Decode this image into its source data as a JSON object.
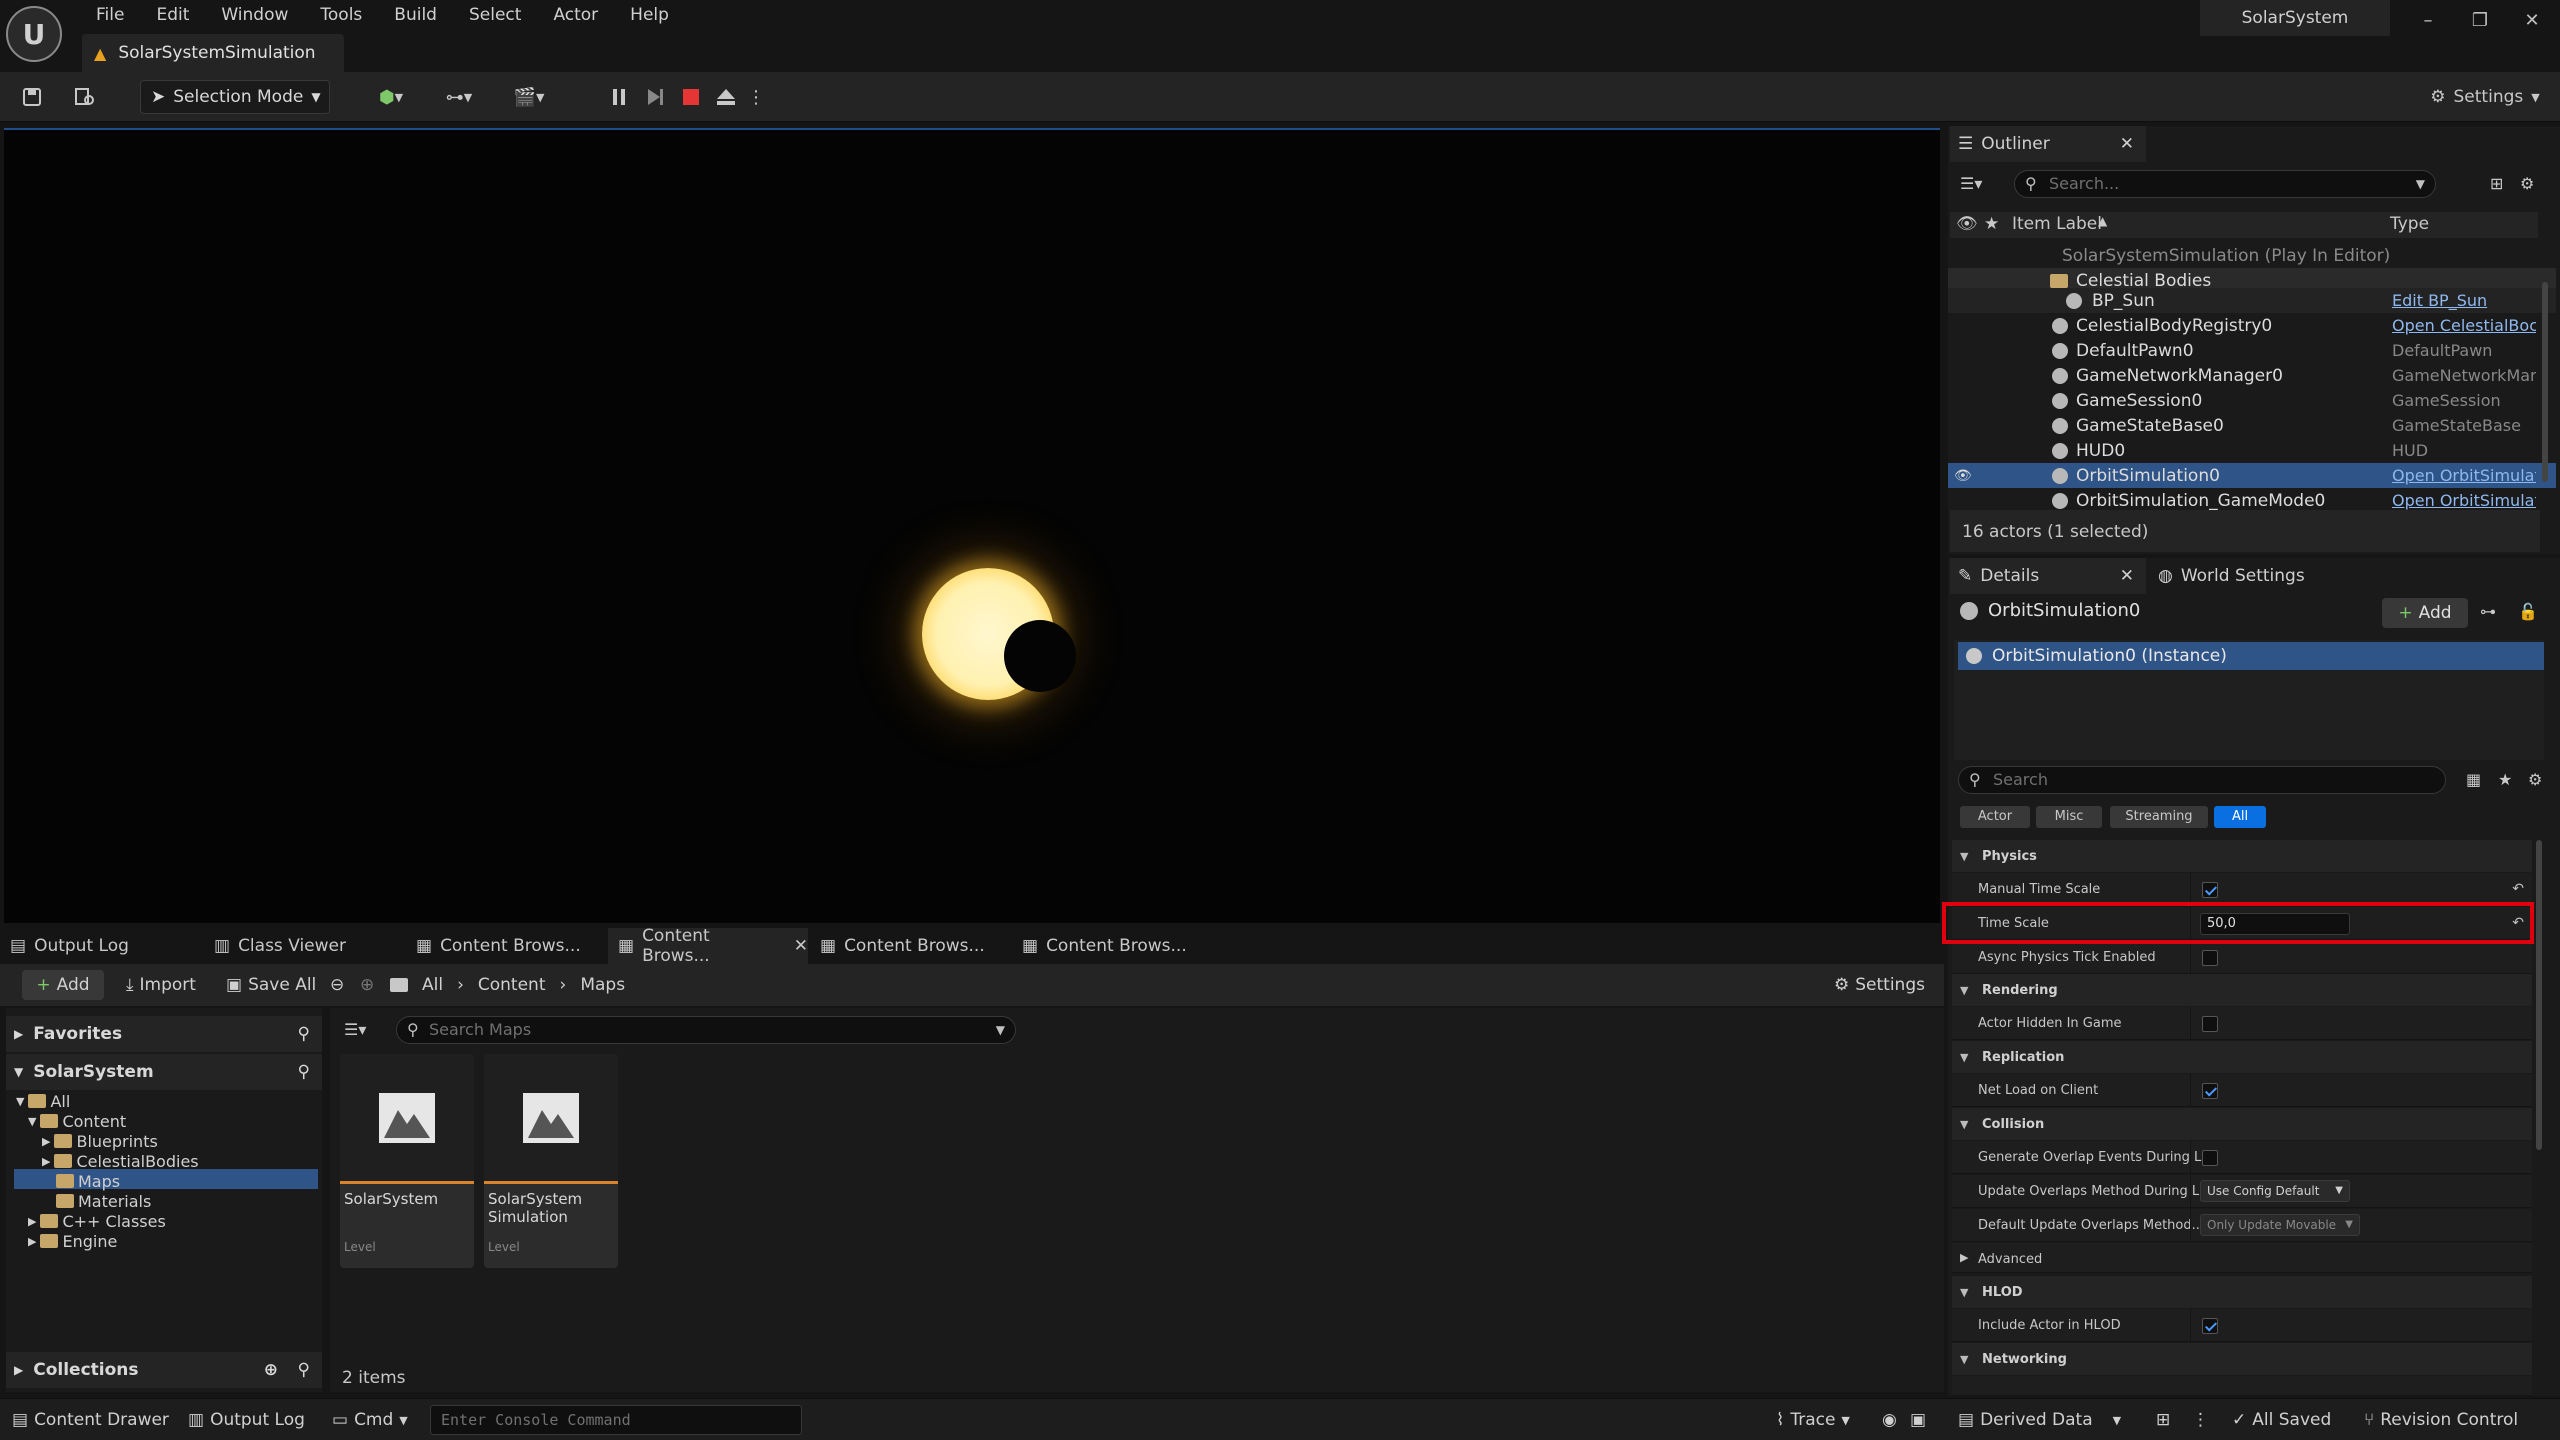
{
  "menu": [
    "File",
    "Edit",
    "Window",
    "Tools",
    "Build",
    "Select",
    "Actor",
    "Help"
  ],
  "doc_tab": "SolarSystemSimulation",
  "project_name": "SolarSystem",
  "toolbar": {
    "selection_mode": "Selection Mode",
    "settings": "Settings"
  },
  "bottom_tabs": [
    "Output Log",
    "Class Viewer",
    "Content Brows...",
    "Content Brows...",
    "Content Brows...",
    "Content Brows..."
  ],
  "content_browser": {
    "add": "Add",
    "import": "Import",
    "save_all": "Save All",
    "path": [
      "All",
      "Content",
      "Maps"
    ],
    "settings": "Settings",
    "favorites": "Favorites",
    "root": "SolarSystem",
    "tree": {
      "all": "All",
      "content": "Content",
      "blueprints": "Blueprints",
      "celestial": "CelestialBodies",
      "maps": "Maps",
      "materials": "Materials",
      "cpp": "C++ Classes",
      "engine": "Engine"
    },
    "search_placeholder": "Search Maps",
    "collections": "Collections",
    "assets": [
      {
        "name": "SolarSystem",
        "kind": "Level"
      },
      {
        "name": "SolarSystem Simulation",
        "kind": "Level"
      }
    ],
    "item_count": "2 items"
  },
  "status": {
    "content_drawer": "Content Drawer",
    "output_log": "Output Log",
    "cmd": "Cmd",
    "console_placeholder": "Enter Console Command",
    "trace": "Trace",
    "derived": "Derived Data",
    "saved": "All Saved",
    "revision": "Revision Control"
  },
  "outliner": {
    "tab": "Outliner",
    "search_placeholder": "Search...",
    "col_label": "Item Label",
    "col_type": "Type",
    "root": "SolarSystemSimulation (Play In Editor)",
    "folder": "Celestial Bodies",
    "rows": [
      {
        "label": "BP_Sun",
        "type": "Edit BP_Sun",
        "link": true
      },
      {
        "label": "CelestialBodyRegistry0",
        "type": "Open CelestialBoc",
        "link": true
      },
      {
        "label": "DefaultPawn0",
        "type": "DefaultPawn",
        "link": false
      },
      {
        "label": "GameNetworkManager0",
        "type": "GameNetworkMar",
        "link": false
      },
      {
        "label": "GameSession0",
        "type": "GameSession",
        "link": false
      },
      {
        "label": "GameStateBase0",
        "type": "GameStateBase",
        "link": false
      },
      {
        "label": "HUD0",
        "type": "HUD",
        "link": false
      },
      {
        "label": "OrbitSimulation0",
        "type": "Open OrbitSimulat",
        "link": true
      },
      {
        "label": "OrbitSimulation_GameMode0",
        "type": "Open OrbitSimulat",
        "link": true
      }
    ],
    "actor_count": "16 actors (1 selected)"
  },
  "details": {
    "tab": "Details",
    "world_tab": "World Settings",
    "object": "OrbitSimulation0",
    "add": "Add",
    "instance": "OrbitSimulation0 (Instance)",
    "search_placeholder": "Search",
    "filters": [
      "Actor",
      "Misc",
      "Streaming",
      "All"
    ],
    "sections": {
      "physics": "Physics",
      "rendering": "Rendering",
      "replication": "Replication",
      "collision": "Collision",
      "advanced": "Advanced",
      "hlod": "HLOD",
      "networking": "Networking"
    },
    "props": {
      "manual_time_scale": "Manual Time Scale",
      "time_scale": "Time Scale",
      "time_scale_value": "50,0",
      "async_physics": "Async Physics Tick Enabled",
      "actor_hidden": "Actor Hidden In Game",
      "net_load": "Net Load on Client",
      "gen_overlap": "Generate Overlap Events During L...",
      "update_overlap": "Update Overlaps Method During L...",
      "update_overlap_value": "Use Config Default",
      "default_update": "Default Update Overlaps Method...",
      "default_update_value": "Only Update Movable",
      "include_hlod": "Include Actor in HLOD"
    }
  },
  "colors": {
    "accent": "#0a6fe0",
    "selection": "#2f5487",
    "highlight_box": "#e0000e",
    "sun": "#fff1b0"
  }
}
